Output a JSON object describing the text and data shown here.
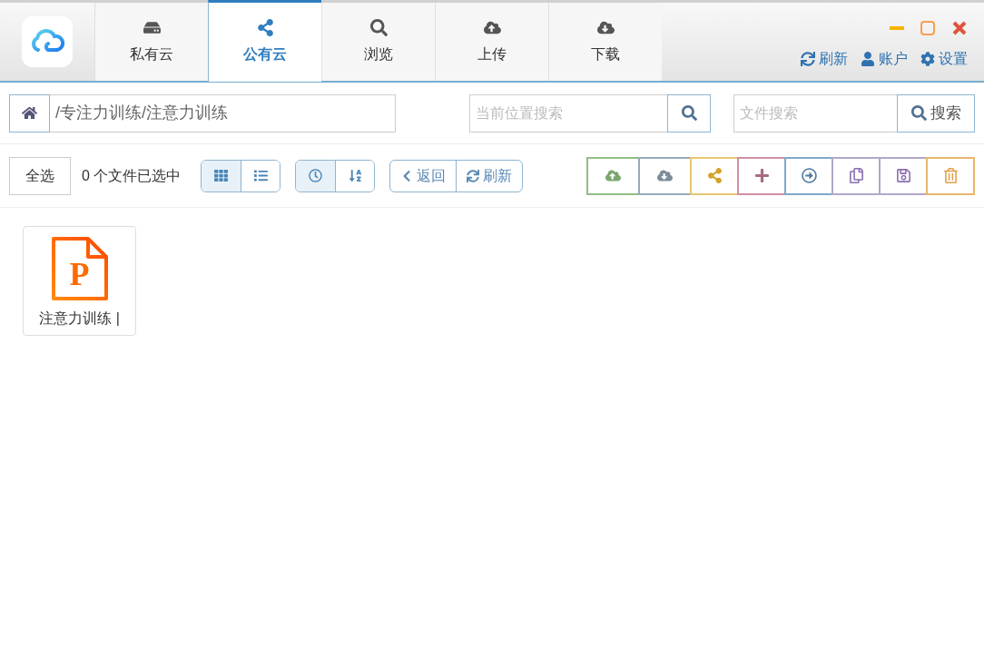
{
  "tabs": [
    {
      "kind": "drive",
      "label": "私有云",
      "selected": false
    },
    {
      "kind": "share",
      "label": "公有云",
      "selected": true
    },
    {
      "kind": "search",
      "label": "浏览",
      "selected": false
    },
    {
      "kind": "upload",
      "label": "上传",
      "selected": false
    },
    {
      "kind": "download",
      "label": "下载",
      "selected": false
    }
  ],
  "header_links": [
    {
      "kind": "refresh",
      "label": "刷新"
    },
    {
      "kind": "user",
      "label": "账户"
    },
    {
      "kind": "settings",
      "label": "设置"
    }
  ],
  "path": {
    "value": "/专注力训练/注意力训练"
  },
  "location_search": {
    "placeholder": "当前位置搜索"
  },
  "file_search": {
    "placeholder": "文件搜索",
    "button": "搜索"
  },
  "select_all": "全选",
  "selection_status": "0 个文件已选中",
  "view_modes": [
    {
      "kind": "grid",
      "selected": true
    },
    {
      "kind": "list",
      "selected": false
    }
  ],
  "sort_modes": [
    {
      "kind": "time",
      "selected": true
    },
    {
      "kind": "name",
      "selected": false
    }
  ],
  "nav_buttons": [
    {
      "kind": "back",
      "label": "返回"
    },
    {
      "kind": "refresh",
      "label": "刷新"
    }
  ],
  "actions": [
    {
      "kind": "upload",
      "color": "#8fbf84"
    },
    {
      "kind": "download",
      "color": "#97aabb"
    },
    {
      "kind": "share",
      "color": "#e8c770"
    },
    {
      "kind": "add",
      "color": "#cf8fa5"
    },
    {
      "kind": "move",
      "color": "#7fa8c9"
    },
    {
      "kind": "copy",
      "color": "#b1a7c9"
    },
    {
      "kind": "save",
      "color": "#b1a7c9"
    },
    {
      "kind": "delete",
      "color": "#e8b66a"
    }
  ],
  "files": [
    {
      "name": "注意力训练 |",
      "icon_letter": "P",
      "selected": false
    }
  ]
}
